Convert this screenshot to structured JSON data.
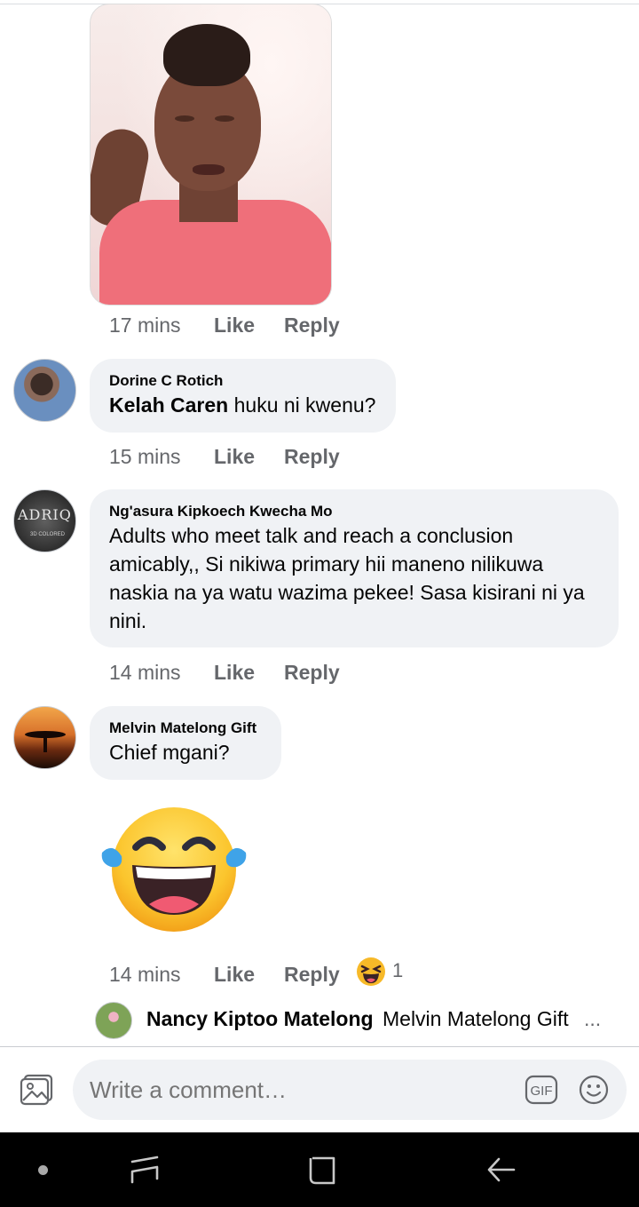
{
  "comments": [
    {
      "time": "17 mins",
      "like": "Like",
      "reply": "Reply"
    },
    {
      "author": "Dorine C Rotich",
      "mention": "Kelah Caren",
      "text": " huku ni kwenu?",
      "time": "15 mins",
      "like": "Like",
      "reply": "Reply"
    },
    {
      "author": "Ng'asura Kipkoech Kwecha Mo",
      "text": "Adults who meet talk and reach a conclusion amicably,, Si nikiwa primary hii maneno nilikuwa naskia na ya watu wazima pekee! Sasa kisirani ni ya nini.",
      "time": "14 mins",
      "like": "Like",
      "reply": "Reply"
    },
    {
      "author": "Melvin Matelong Gift",
      "text": "Chief mgani?",
      "sticker": "laughing-tears-emoji",
      "time": "14 mins",
      "like": "Like",
      "reply": "Reply",
      "reaction_icon": "laughing-squint-emoji",
      "reaction_count": "1"
    }
  ],
  "reply_preview": {
    "author": "Nancy Kiptoo Matelong",
    "text": "Melvin Matelong Gift",
    "ellipsis": "..."
  },
  "avatar_labels": {
    "ngasura_logo": "ADRIQ",
    "ngasura_logo_sub": "3D COLORED"
  },
  "composer": {
    "placeholder": "Write a comment…",
    "gif_label": "GIF",
    "photo_icon": "photo-icon",
    "emoji_icon": "smiley-icon"
  },
  "colors": {
    "bubble": "#f0f2f5",
    "meta_text": "#65676b",
    "name_text": "#050505",
    "nav_bar": "#000000"
  }
}
